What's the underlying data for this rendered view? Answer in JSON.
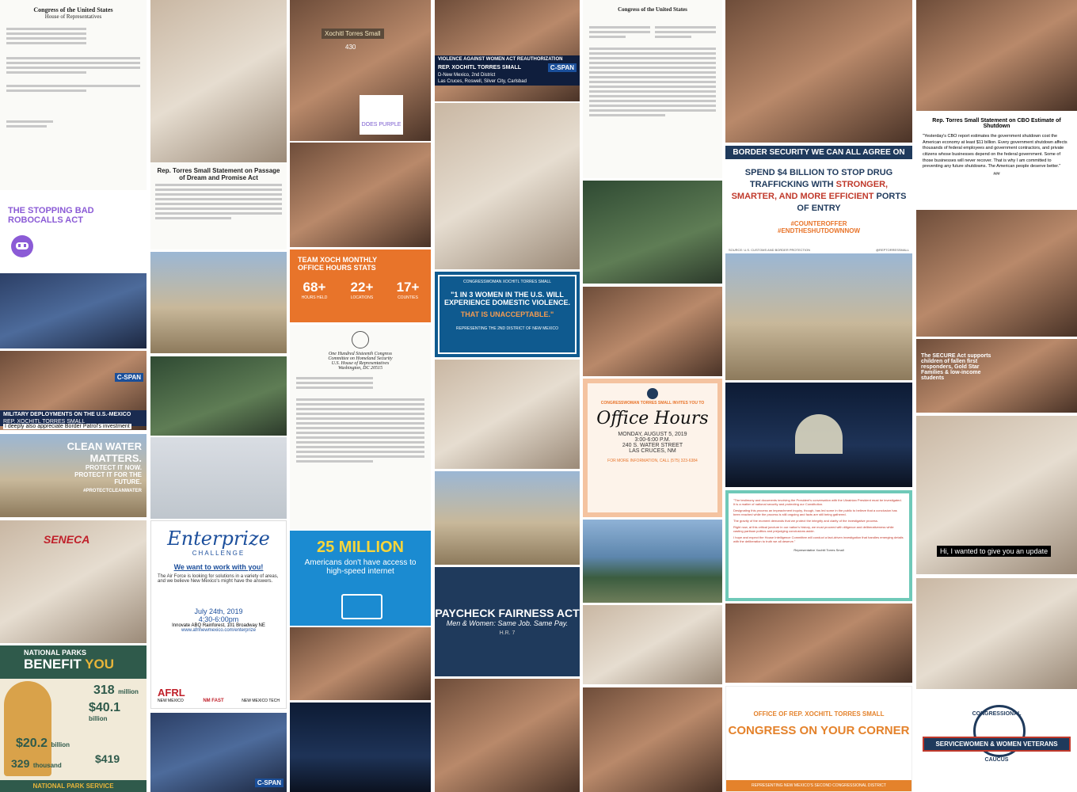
{
  "letter_header": "Congress of the United States",
  "letter_subheader": "House of Representatives",
  "dream_title": "Rep. Torres Small Statement on Passage of Dream and Promise Act",
  "robocalls_title": "THE STOPPING BAD ROBOCALLS ACT",
  "nameplate": "Xochitl Torres Small",
  "does_purple": "DOES PURPLE",
  "room_number": "430",
  "vawa_title": "VIOLENCE AGAINST WOMEN ACT REAUTHORIZATION",
  "vawa_name": "REP. XOCHITL TORRES SMALL",
  "vawa_party": "D-New Mexico, 2nd District",
  "vawa_place": "Las Cruces, Roswell, Silver City, Carlsbad",
  "cspan": "C-SPAN",
  "border_title": "BORDER SECURITY WE CAN ALL AGREE ON",
  "border_body_1": "SPEND $4 BILLION TO STOP DRUG TRAFFICKING WITH",
  "border_body_2": "STRONGER, SMARTER,",
  "border_body_3": "AND MORE EFFICIENT",
  "border_body_4": "PORTS OF ENTRY",
  "border_hashtag1": "#COUNTEROFFER",
  "border_hashtag2": "#ENDTHESHUTDOWNNOW",
  "border_source": "SOURCE: U.S. CUSTOMS AND BORDER PROTECTION",
  "border_handle": "@REPTORRESSMALL",
  "cbo_title": "Rep. Torres Small Statement on CBO Estimate of Shutdown",
  "cbo_body": "\"Yesterday's CBO report estimates the government shutdown cost the American economy at least $11 billion. Every government shutdown affects thousands of federal employees and government contractors, and private citizens whose businesses depend on the federal government. Some of those businesses will never recover. That is why I am committed to preventing any future shutdowns. The American people deserve better.\"",
  "cbo_end": "###",
  "office_stats_title": "TEAM XOCH MONTHLY OFFICE HOURS STATS",
  "stat1_num": "68+",
  "stat1_label": "HOURS HELD",
  "stat2_num": "22+",
  "stat2_label": "LOCATIONS",
  "stat3_num": "17+",
  "stat3_label": "COUNTIES",
  "dv_top": "CONGRESSWOMAN XOCHITL TORRES SMALL",
  "dv_quote": "\"1 IN 3 WOMEN IN THE U.S. WILL EXPERIENCE DOMESTIC VIOLENCE.",
  "dv_emph": "THAT IS UNACCEPTABLE.\"",
  "dv_bottom": "REPRESENTING THE 2ND DISTRICT OF NEW MEXICO",
  "military_title": "MILITARY DEPLOYMENTS ON THE U.S.-MEXICO BORDER",
  "military_name": "REP. XOCHITL TORRES SMALL",
  "military_quote": "I deeply also appreciate Border Patrol's investment",
  "clean_water_1": "CLEAN WATER",
  "clean_water_2": "MATTERS.",
  "clean_water_3": "PROTECT IT NOW.",
  "clean_water_4": "PROTECT IT FOR THE",
  "clean_water_5": "FUTURE.",
  "clean_water_tag": "#PROTECTCLEANWATER",
  "secure_act": "The SECURE Act supports children of fallen first responders, Gold Star Families & low-income students",
  "office_hours_invite": "CONGRESSWOMAN TORRES SMALL INVITES YOU TO",
  "office_hours_title": "Office Hours",
  "office_hours_date": "MONDAY, AUGUST 5, 2019",
  "office_hours_time": "3:00-6:00 P.M.",
  "office_hours_addr": "240 S. WATER STREET",
  "office_hours_city": "LAS CRUCES, NM",
  "office_hours_info": "FOR MORE INFORMATION, CALL (575) 323-6384",
  "impeach_p1": "\"The testimony and documents involving the President's conversation with the Ukrainian President must be investigated. It is a matter of national security and protecting our Constitution.",
  "impeach_p2": "Designating this process an impeachment inquiry, though, has led some in the public to believe that a conclusion has been reached while the process is still ongoing and facts are still being gathered.",
  "impeach_p3": "The gravity of the moment demands that we protect the integrity and clarity of the investigative process.",
  "impeach_p4": "Right now, at this critical juncture in our nation's history, we must proceed with diligence and deliberativeness while casting partisan politics and prejudging conclusions aside.",
  "impeach_p5": "I hope and expect the House Intelligence Committee will conduct a fact-driven investigation that handles emerging details with the deliberation to truth we all deserve.\"",
  "impeach_sig": "Representative Xochitl Torres Small",
  "update_caption": "Hi, I wanted to give you an update",
  "broadband_num": "25 MILLION",
  "broadband_text": "Americans don't have access to high-speed internet",
  "paycheck_title": "PAYCHECK FAIRNESS ACT",
  "paycheck_sub": "Men & Women: Same Job. Same Pay.",
  "paycheck_hr": "H.R. 7",
  "enterprize_title": "Enterprize",
  "enterprize_sub": "CHALLENGE",
  "enterprize_head": "We want to work with you!",
  "enterprize_body": "The Air Force is looking for solutions in a variety of areas, and we believe New Mexico's might have the answers.",
  "enterprize_date": "July 24th, 2019",
  "enterprize_time": "4:30-6:00pm",
  "enterprize_venue": "Innovate ABQ Rainforest, 101 Broadway NE",
  "enterprize_url": "www.afrlnewmexico.com/enterprize",
  "afrl": "AFRL",
  "afrl_sub": "NEW MEXICO",
  "nmtech": "NEW MEXICO TECH",
  "nmfast": "NM FAST",
  "parks_top": "NATIONAL PARKS",
  "parks_big": "BENEFIT",
  "parks_you": "YOU",
  "parks_stat1": "318",
  "parks_stat1_label": "million",
  "parks_stat2": "$40.1",
  "parks_stat2_label": "billion",
  "parks_stat3": "$20.2",
  "parks_stat3_label": "billion",
  "parks_stat4": "329",
  "parks_stat4_label": "thousand",
  "parks_stat5": "$419",
  "parks_footer": "NATIONAL PARK SERVICE",
  "seneca": "SENECA",
  "corner_top": "OFFICE OF REP. XOCHITL TORRES SMALL",
  "corner_title": "CONGRESS ON YOUR CORNER",
  "corner_bottom": "REPRESENTING NEW MEXICO'S SECOND CONGRESSIONAL DISTRICT",
  "caucus_top": "CONGRESSIONAL",
  "caucus_mid": "SERVICEWOMEN & WOMEN VETERANS",
  "caucus_bot": "CAUCUS",
  "hs_header_1": "One Hundred Sixteenth Congress",
  "hs_header_2": "Committee on Homeland Security",
  "hs_header_3": "U.S. House of Representatives",
  "hs_header_4": "Washington, DC 20515",
  "colors": {
    "orange": "#e8742a",
    "navy": "#1f3a5c",
    "dvblue": "#0f5a8f",
    "purple": "#8b5bd6",
    "corner_orange": "#e4822b"
  },
  "icons": [
    "robot-icon",
    "laptop-icon",
    "capitol-icon",
    "bison-icon",
    "seal-icon"
  ]
}
